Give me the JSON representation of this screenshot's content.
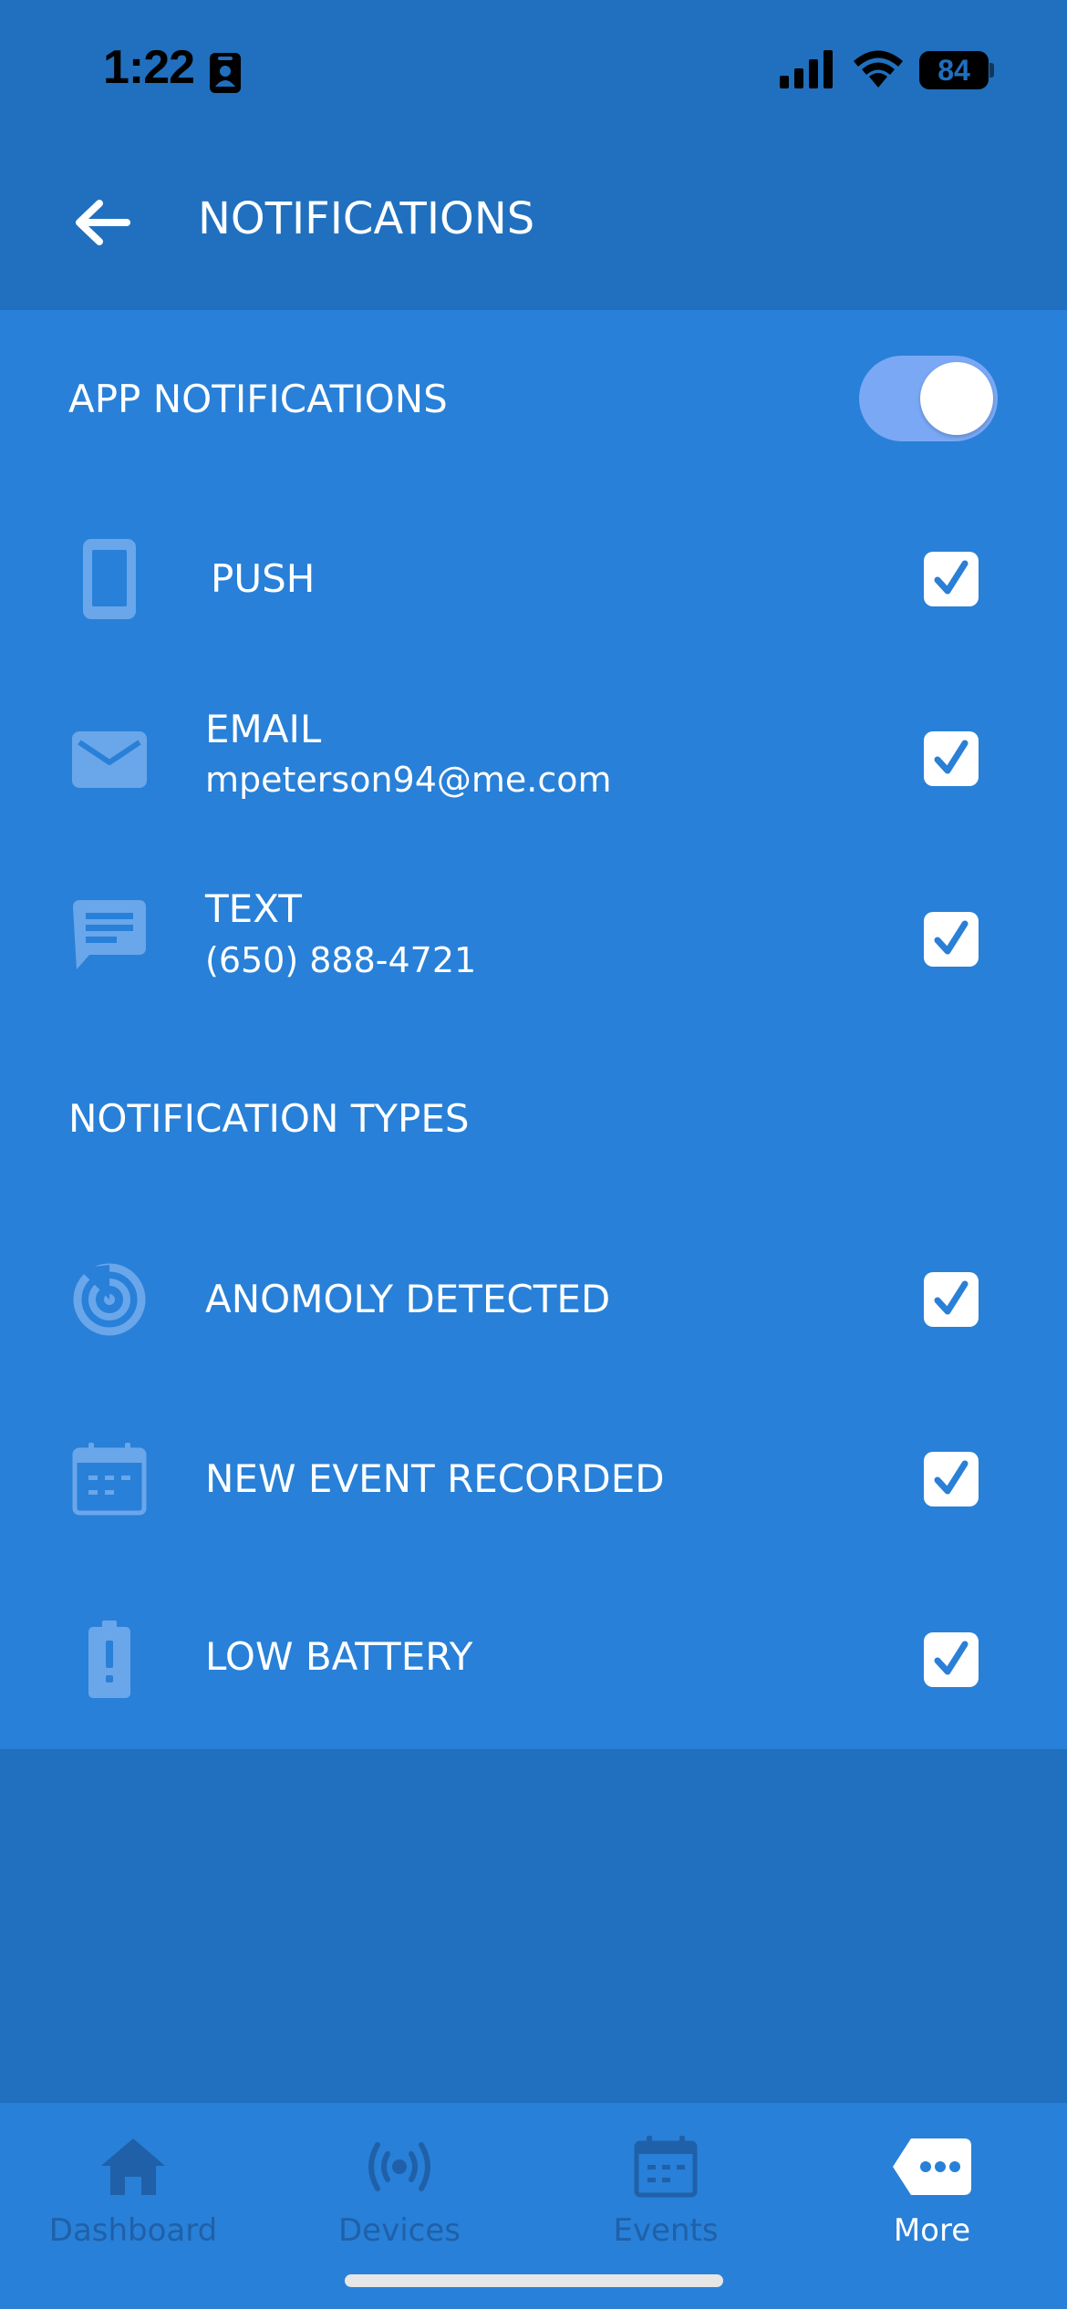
{
  "status_bar": {
    "time": "1:22",
    "battery": "84"
  },
  "header": {
    "title": "NOTIFICATIONS"
  },
  "app_notifications": {
    "title": "APP NOTIFICATIONS",
    "enabled": true,
    "channels": [
      {
        "label": "PUSH",
        "sub": "",
        "icon": "phone-icon",
        "checked": true
      },
      {
        "label": "EMAIL",
        "sub": "mpeterson94@me.com",
        "icon": "mail-icon",
        "checked": true
      },
      {
        "label": "TEXT",
        "sub": "(650) 888-4721",
        "icon": "message-icon",
        "checked": true
      }
    ]
  },
  "notification_types": {
    "title": "NOTIFICATION TYPES",
    "items": [
      {
        "label": "ANOMOLY DETECTED",
        "icon": "radar-icon",
        "checked": true
      },
      {
        "label": "NEW EVENT RECORDED",
        "icon": "calendar-icon",
        "checked": true
      },
      {
        "label": "LOW BATTERY",
        "icon": "battery-alert-icon",
        "checked": true
      }
    ]
  },
  "tabbar": {
    "tabs": [
      {
        "label": "Dashboard",
        "icon": "home-icon",
        "active": false
      },
      {
        "label": "Devices",
        "icon": "broadcast-icon",
        "active": false
      },
      {
        "label": "Events",
        "icon": "calendar-icon",
        "active": false
      },
      {
        "label": "More",
        "icon": "more-icon",
        "active": true
      }
    ]
  },
  "colors": {
    "background": "#2070bf",
    "content": "#2880d8",
    "toggle_track": "#7aa8f5",
    "check": "#2a7fd6",
    "inactive_tab": "#2060a8"
  }
}
